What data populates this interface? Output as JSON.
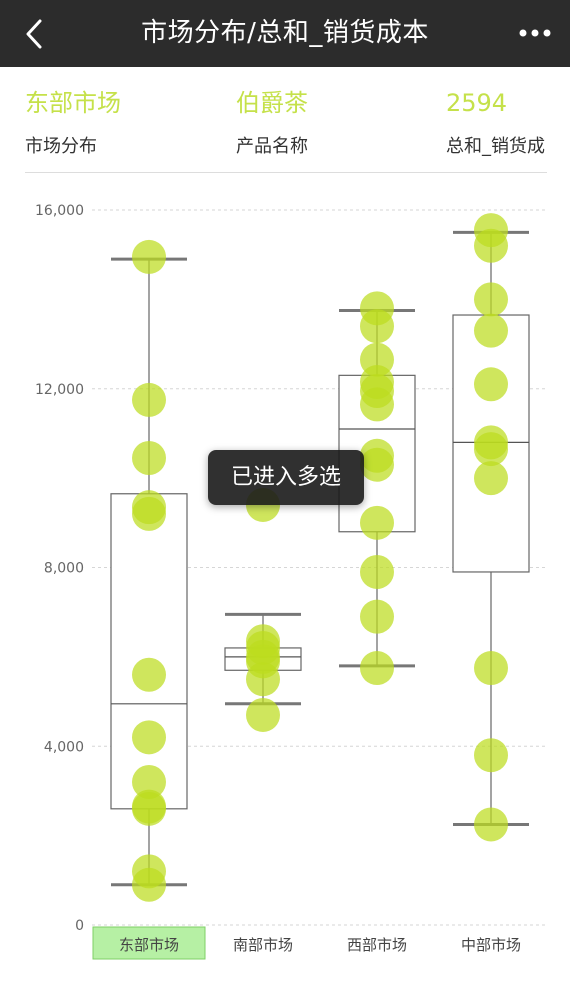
{
  "header": {
    "title": "市场分布/总和_销货成本",
    "back_icon": "chevron-left-icon",
    "more_icon": "more-dots-icon"
  },
  "info": [
    {
      "value": "东部市场",
      "label": "市场分布"
    },
    {
      "value": "伯爵茶",
      "label": "产品名称"
    },
    {
      "value": "2594",
      "label": "总和_销货成"
    }
  ],
  "toast": "已进入多选",
  "colors": {
    "accent": "#c5e14a",
    "point": "#bddd1f",
    "selected_fill": "#b6f0a4",
    "selected_border": "#7fcf66"
  },
  "chart_data": {
    "type": "boxplot",
    "y_ticks": [
      "0",
      "4,000",
      "8,000",
      "12,000",
      "16,000"
    ],
    "ylim": [
      0,
      16000
    ],
    "grid": true,
    "selected_category": "东部市场",
    "categories": [
      "东部市场",
      "南部市场",
      "西部市场",
      "中部市场"
    ],
    "boxes": [
      {
        "category": "东部市场",
        "whisker_low": 900,
        "q1": 2600,
        "median": 4950,
        "q3": 9650,
        "whisker_high": 14900,
        "points": [
          14950,
          11750,
          10450,
          9350,
          9200,
          5600,
          4200,
          3200,
          2600,
          2650,
          1200,
          900
        ]
      },
      {
        "category": "南部市场",
        "whisker_low": 4950,
        "q1": 5700,
        "median": 6000,
        "q3": 6200,
        "whisker_high": 6950,
        "points": [
          9400,
          6350,
          6200,
          6000,
          5900,
          5500,
          4700
        ]
      },
      {
        "category": "西部市场",
        "whisker_low": 5800,
        "q1": 8800,
        "median": 11100,
        "q3": 12300,
        "whisker_high": 13750,
        "points": [
          13800,
          13400,
          12650,
          12150,
          11950,
          11650,
          10500,
          10300,
          9000,
          7900,
          6900,
          5750
        ]
      },
      {
        "category": "中部市场",
        "whisker_low": 2250,
        "q1": 7900,
        "median": 10800,
        "q3": 13650,
        "whisker_high": 15500,
        "points": [
          15550,
          15200,
          14000,
          13300,
          12100,
          10800,
          10650,
          10000,
          5750,
          3800,
          2250
        ]
      }
    ]
  }
}
